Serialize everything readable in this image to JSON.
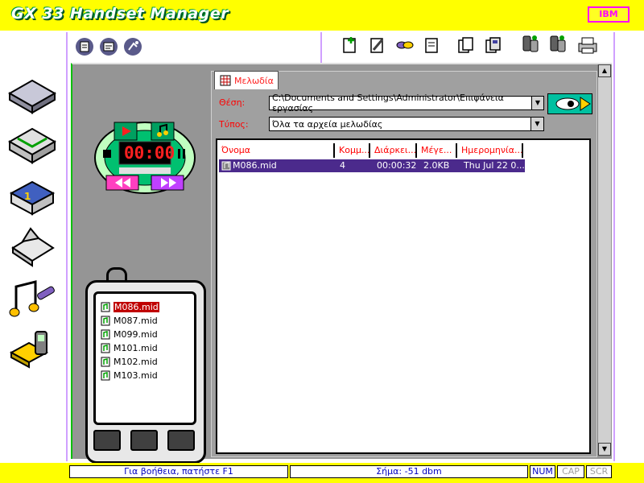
{
  "window": {
    "title": "GX 33 Handset Manager",
    "brand": "IBM"
  },
  "toolbar": {
    "left_icons": [
      "new-file-icon",
      "edit-file-icon",
      "sync-icon"
    ],
    "right_icons": [
      "add-icon",
      "edit-pencil-icon",
      "link-icon",
      "copy-icon",
      "paste-icon",
      "save-icon",
      "phone-connect-icon",
      "phone-settings-icon",
      "printer-icon"
    ]
  },
  "nav": {
    "items": [
      "phonebook-icon",
      "messages-icon",
      "calendar-icon",
      "notes-icon",
      "music-icon",
      "connectivity-icon"
    ]
  },
  "player": {
    "time": "00:00"
  },
  "phone": {
    "files": [
      {
        "name": "M086.mid",
        "selected": true
      },
      {
        "name": "M087.mid",
        "selected": false
      },
      {
        "name": "M099.mid",
        "selected": false
      },
      {
        "name": "M101.mid",
        "selected": false
      },
      {
        "name": "M102.mid",
        "selected": false
      },
      {
        "name": "M103.mid",
        "selected": false
      }
    ]
  },
  "content": {
    "tab_label": "Μελωδία",
    "location_label": "Θέση:",
    "location_value": "C:\\Documents and Settings\\Administrator\\Επιφάνεια εργασίας",
    "type_label": "Τύπος:",
    "type_value": "Όλα τα αρχεία μελωδίας",
    "columns": [
      "Όνομα",
      "Κομμ...",
      "Διάρκει...",
      "Μέγε...",
      "Ημερομηνία..."
    ],
    "rows": [
      {
        "name": "M086.mid",
        "comment": "4",
        "duration": "00:00:32",
        "size": "2.0KB",
        "date": "Thu Jul 22 0..."
      }
    ]
  },
  "status": {
    "help": "Για βοήθεια, πατήστε F1",
    "signal": "Σήμα: -51 dbm",
    "num": "NUM",
    "cap": "CAP",
    "scr": "SCR"
  },
  "colors": {
    "chrome": "#ffff00",
    "selection": "#4b2a8c",
    "label": "#ff0000",
    "panel": "#959595"
  }
}
